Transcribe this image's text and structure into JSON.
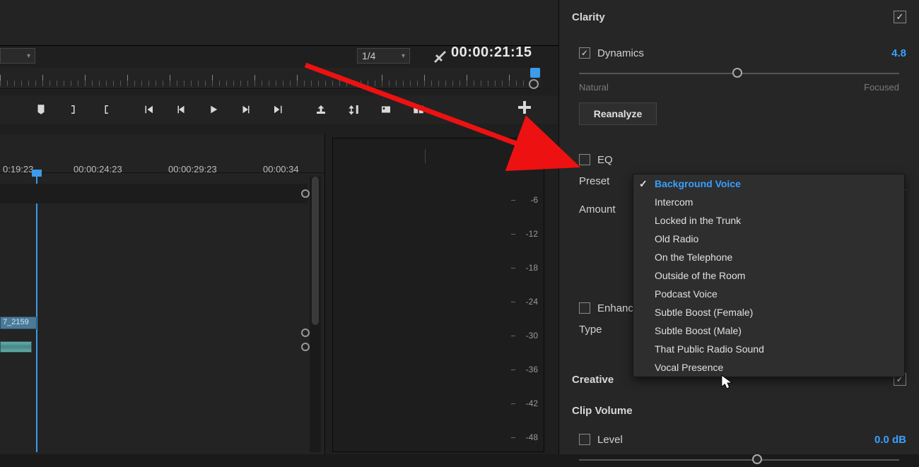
{
  "toolbar": {
    "resolution": "1/4",
    "timecode": "00:00:21:15"
  },
  "timeline": {
    "labels": [
      "0:19:23",
      "00:00:24:23",
      "00:00:29:23",
      "00:00:34"
    ],
    "clip_name": "7_2159"
  },
  "meter": {
    "ticks": [
      "-6",
      "-12",
      "-18",
      "-24",
      "-30",
      "-36",
      "-42",
      "-48"
    ]
  },
  "panel": {
    "clarity": {
      "title": "Clarity"
    },
    "dynamics": {
      "label": "Dynamics",
      "value": "4.8",
      "left": "Natural",
      "right": "Focused",
      "reanalyze": "Reanalyze"
    },
    "eq": {
      "label": "EQ",
      "preset_label": "Preset",
      "amount_label": "Amount",
      "selected": "Background Voice"
    },
    "enhance": {
      "label": "Enhance",
      "type_label": "Type"
    },
    "creative": {
      "title": "Creative"
    },
    "clip_volume": {
      "title": "Clip Volume",
      "level_label": "Level",
      "level_value": "0.0 dB"
    }
  },
  "preset_options": [
    "Background Voice",
    "Intercom",
    "Locked in the Trunk",
    "Old Radio",
    "On the Telephone",
    "Outside of the Room",
    "Podcast Voice",
    "Subtle Boost (Female)",
    "Subtle Boost (Male)",
    "That Public Radio Sound",
    "Vocal Presence"
  ]
}
